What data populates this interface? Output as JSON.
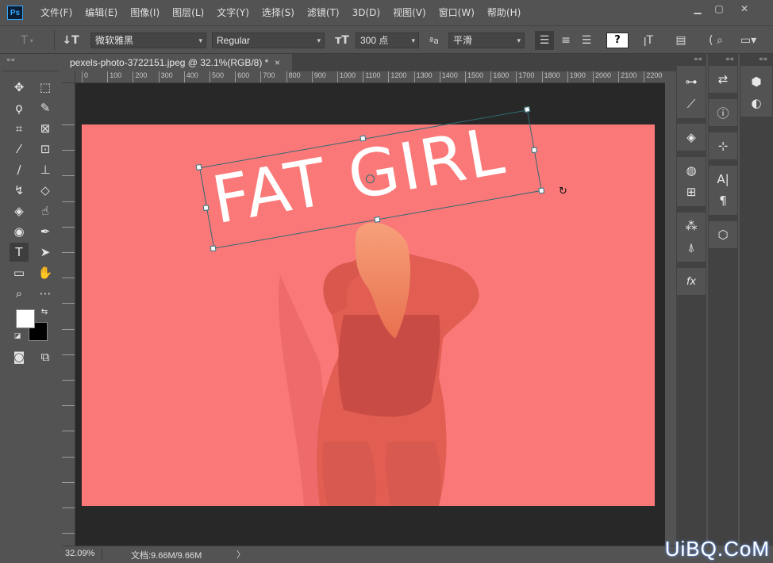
{
  "app": {
    "logo": "Ps",
    "menu": [
      "文件(F)",
      "编辑(E)",
      "图像(I)",
      "图层(L)",
      "文字(Y)",
      "选择(S)",
      "滤镜(T)",
      "3D(D)",
      "视图(V)",
      "窗口(W)",
      "帮助(H)"
    ],
    "window_controls": [
      "minimize-icon",
      "restore-icon",
      "close-icon"
    ]
  },
  "options": {
    "font_family": "微软雅黑",
    "font_style": "Regular",
    "font_size": "300 点",
    "antialias_icon": "aa-icon",
    "antialias": "平滑",
    "align": [
      "align-left-icon",
      "align-center-icon",
      "align-right-icon"
    ],
    "text_color": "#ffffff"
  },
  "document": {
    "tab_label": "pexels-photo-3722151.jpeg @ 32.1%(RGB/8) *",
    "close_icon": "×",
    "canvas_text": "FAT GIRL",
    "canvas_bg": "#fb7878",
    "text_rotation_deg": -10
  },
  "ruler": {
    "labels": [
      "0",
      "100",
      "200",
      "300",
      "400",
      "500",
      "600",
      "700",
      "800",
      "900",
      "1000",
      "1100",
      "1200",
      "1300",
      "1400",
      "1500",
      "1600",
      "1700",
      "1800",
      "1900",
      "2000",
      "2100",
      "2200"
    ]
  },
  "status": {
    "zoom": "32.09%",
    "doc_size": "文档:9.66M/9.66M",
    "arrow": "〉"
  },
  "panels": {
    "collapse": "««"
  },
  "watermark": "UiBQ.CoM"
}
